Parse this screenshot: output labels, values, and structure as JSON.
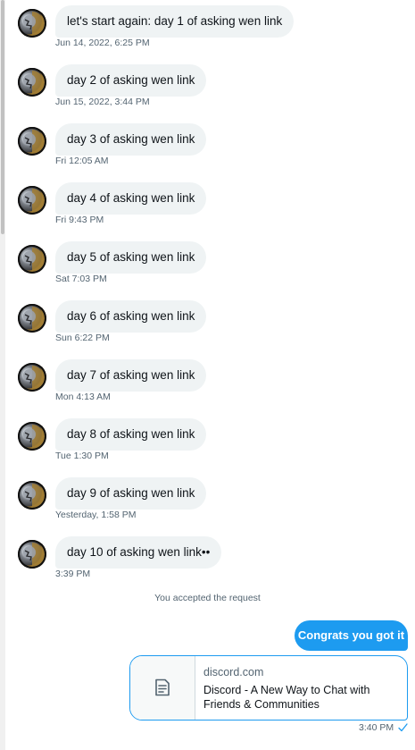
{
  "messages": [
    {
      "text": "let's start again: day 1 of asking wen link",
      "time": "Jun 14, 2022, 6:25 PM"
    },
    {
      "text": "day 2 of asking wen link",
      "time": "Jun 15, 2022, 3:44 PM"
    },
    {
      "text": "day 3 of asking wen link",
      "time": "Fri 12:05 AM"
    },
    {
      "text": "day 4 of asking wen link",
      "time": "Fri 9:43 PM"
    },
    {
      "text": "day 5 of asking wen link",
      "time": "Sat 7:03 PM"
    },
    {
      "text": "day 6 of asking wen link",
      "time": "Sun 6:22 PM"
    },
    {
      "text": "day 7 of asking wen link",
      "time": "Mon 4:13 AM"
    },
    {
      "text": "day 8 of asking wen link",
      "time": "Tue 1:30 PM"
    },
    {
      "text": "day 9 of asking wen link",
      "time": "Yesterday, 1:58 PM"
    },
    {
      "text": "day 10 of asking wen link••",
      "time": "3:39 PM"
    }
  ],
  "system_notice": "You accepted the request",
  "outgoing": {
    "text": "Congrats you got it",
    "link_card": {
      "domain": "discord.com",
      "title": "Discord - A New Way to Chat with Friends & Communities"
    },
    "time": "3:40 PM"
  },
  "colors": {
    "accent": "#1d9bf0",
    "bubble_incoming": "#eff3f4",
    "meta_text": "#536471"
  },
  "icons": {
    "link_card": "document-icon",
    "delivery": "check-icon"
  }
}
